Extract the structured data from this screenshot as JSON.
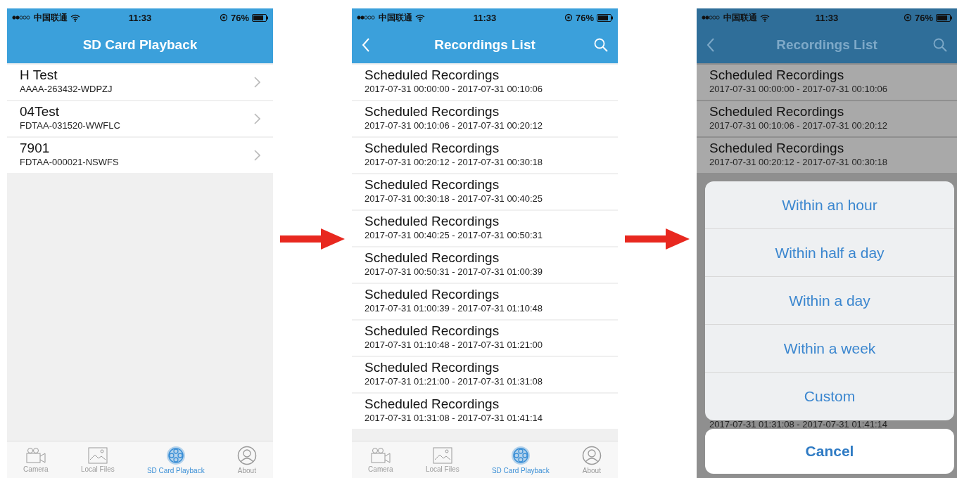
{
  "screens": [
    {
      "dimmed": false,
      "status_bar": {
        "carrier": "中国联通",
        "time": "11:33",
        "battery": "76%"
      },
      "nav": {
        "title": "SD Card Playback",
        "back": false,
        "search": false
      },
      "rows": [
        {
          "title": "H Test",
          "subtitle": "AAAA-263432-WDPZJ",
          "chevron": true
        },
        {
          "title": "04Test",
          "subtitle": "FDTAA-031520-WWFLC",
          "chevron": true
        },
        {
          "title": "7901",
          "subtitle": "FDTAA-000021-NSWFS",
          "chevron": true
        }
      ],
      "tab_bar": [
        {
          "label": "Camera",
          "kind": "camera",
          "selected": false
        },
        {
          "label": "Local Files",
          "kind": "image",
          "selected": false
        },
        {
          "label": "SD Card Playback",
          "kind": "reel",
          "selected": true
        },
        {
          "label": "About",
          "kind": "person",
          "selected": false
        }
      ]
    },
    {
      "dimmed": false,
      "status_bar": {
        "carrier": "中国联通",
        "time": "11:33",
        "battery": "76%"
      },
      "nav": {
        "title": "Recordings List",
        "back": true,
        "search": true
      },
      "rows": [
        {
          "title": "Scheduled Recordings",
          "subtitle": "2017-07-31 00:00:00 - 2017-07-31 00:10:06",
          "chevron": false
        },
        {
          "title": "Scheduled Recordings",
          "subtitle": "2017-07-31 00:10:06 - 2017-07-31 00:20:12",
          "chevron": false
        },
        {
          "title": "Scheduled Recordings",
          "subtitle": "2017-07-31 00:20:12 - 2017-07-31 00:30:18",
          "chevron": false
        },
        {
          "title": "Scheduled Recordings",
          "subtitle": "2017-07-31 00:30:18 - 2017-07-31 00:40:25",
          "chevron": false
        },
        {
          "title": "Scheduled Recordings",
          "subtitle": "2017-07-31 00:40:25 - 2017-07-31 00:50:31",
          "chevron": false
        },
        {
          "title": "Scheduled Recordings",
          "subtitle": "2017-07-31 00:50:31 - 2017-07-31 01:00:39",
          "chevron": false
        },
        {
          "title": "Scheduled Recordings",
          "subtitle": "2017-07-31 01:00:39 - 2017-07-31 01:10:48",
          "chevron": false
        },
        {
          "title": "Scheduled Recordings",
          "subtitle": "2017-07-31 01:10:48 - 2017-07-31 01:21:00",
          "chevron": false
        },
        {
          "title": "Scheduled Recordings",
          "subtitle": "2017-07-31 01:21:00 - 2017-07-31 01:31:08",
          "chevron": false
        },
        {
          "title": "Scheduled Recordings",
          "subtitle": "2017-07-31 01:31:08 - 2017-07-31 01:41:14",
          "chevron": false
        }
      ],
      "tab_bar": [
        {
          "label": "Camera",
          "kind": "camera",
          "selected": false
        },
        {
          "label": "Local Files",
          "kind": "image",
          "selected": false
        },
        {
          "label": "SD Card Playback",
          "kind": "reel",
          "selected": true
        },
        {
          "label": "About",
          "kind": "person",
          "selected": false
        }
      ]
    },
    {
      "dimmed": true,
      "status_bar": {
        "carrier": "中国联通",
        "time": "11:33",
        "battery": "76%"
      },
      "nav": {
        "title": "Recordings List",
        "back": true,
        "search": true
      },
      "rows": [
        {
          "title": "Scheduled Recordings",
          "subtitle": "2017-07-31 00:00:00 - 2017-07-31 00:10:06",
          "chevron": false
        },
        {
          "title": "Scheduled Recordings",
          "subtitle": "2017-07-31 00:10:06 - 2017-07-31 00:20:12",
          "chevron": false
        },
        {
          "title": "Scheduled Recordings",
          "subtitle": "2017-07-31 00:20:12 - 2017-07-31 00:30:18",
          "chevron": false
        }
      ],
      "action_sheet": {
        "options": [
          "Within an hour",
          "Within half a day",
          "Within a day",
          "Within a week",
          "Custom"
        ],
        "peek": "2017-07-31 01:31:08 - 2017-07-31 01:41:14",
        "cancel": "Cancel"
      }
    }
  ]
}
